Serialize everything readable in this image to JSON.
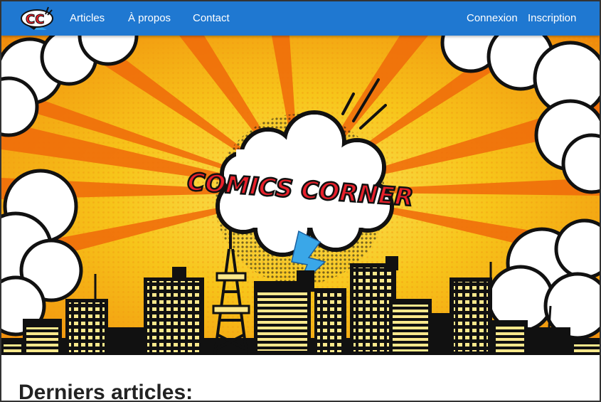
{
  "site": {
    "logo_text": "CC",
    "banner_title": "COMICS CORNER"
  },
  "nav": {
    "left": [
      "Articles",
      "À propos",
      "Contact"
    ],
    "right": [
      "Connexion",
      "Inscription"
    ]
  },
  "main": {
    "section_title": "Derniers articles:"
  },
  "colors": {
    "navbar": "#1f78d1",
    "hero_orange": "#f39a12",
    "hero_yellow": "#f7c51a",
    "title_red": "#e8202b",
    "lightning": "#3aa7e8"
  }
}
